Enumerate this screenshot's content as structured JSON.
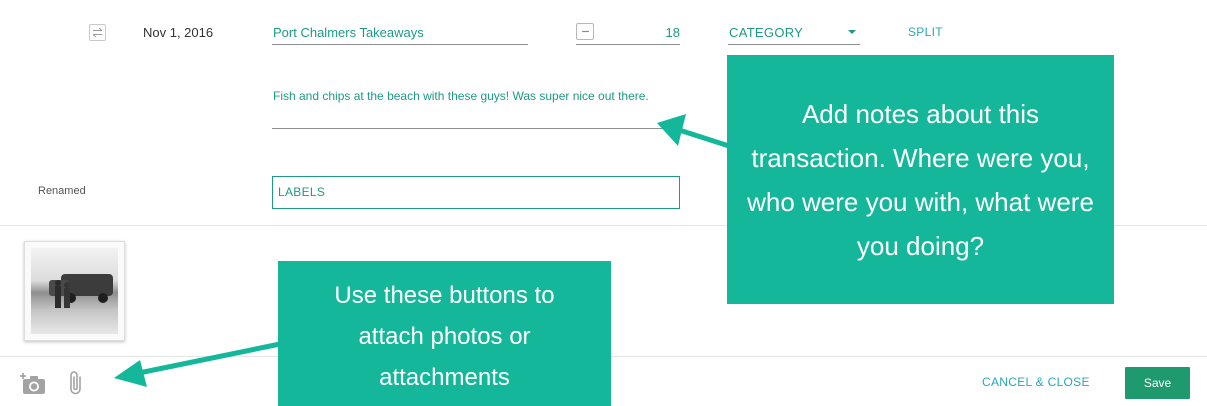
{
  "row": {
    "date": "Nov 1, 2016",
    "payee": "Port Chalmers Takeaways",
    "amount_sign": "−",
    "amount": "18",
    "category": "CATEGORY",
    "split_label": "SPLIT"
  },
  "notes": {
    "value": "Fish and chips at the beach with these guys! Was super nice out there."
  },
  "renamed_label": "Renamed",
  "labels_field": {
    "label": "LABELS"
  },
  "footer": {
    "cancel_label": "CANCEL & CLOSE",
    "save_label": "Save"
  },
  "callouts": {
    "notes_text": "Add notes about this transaction. Where were you, who were you with, what were you doing?",
    "attach_text": "Use these buttons to attach photos or attachments"
  },
  "colors": {
    "accent": "#1d9a86",
    "callout_bg": "#14b79a",
    "save_bg": "#1e9a6e",
    "link": "#29a7b4"
  },
  "icons": {
    "transfer": "transfer-icon",
    "sign": "minus-icon",
    "caret": "caret-down-icon",
    "camera": "camera-add-icon",
    "clip": "paperclip-icon"
  }
}
